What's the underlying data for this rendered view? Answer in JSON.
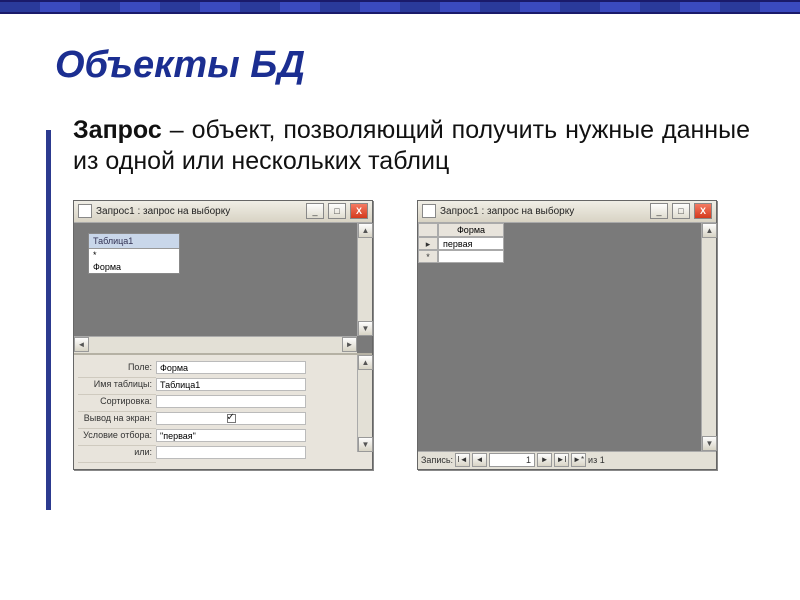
{
  "slide": {
    "title": "Объекты БД",
    "term": "Запрос",
    "definition": "– объект, позволяющий получить нужные данные из одной или нескольких таблиц"
  },
  "windows": {
    "left": {
      "title": "Запрос1 : запрос на выборку",
      "table_box": {
        "header": "Таблица1",
        "rows": [
          "*",
          "Форма"
        ]
      },
      "properties": [
        {
          "label": "Поле:",
          "value": "Форма"
        },
        {
          "label": "Имя таблицы:",
          "value": "Таблица1"
        },
        {
          "label": "Сортировка:",
          "value": ""
        },
        {
          "label": "Вывод на экран:",
          "value": "",
          "checkbox": true,
          "checked": true
        },
        {
          "label": "Условие отбора:",
          "value": "\"первая\""
        },
        {
          "label": "или:",
          "value": ""
        }
      ]
    },
    "right": {
      "title": "Запрос1 : запрос на выборку",
      "column_header": "Форма",
      "rows": [
        {
          "marker": "▸",
          "value": "первая"
        },
        {
          "marker": "*",
          "value": ""
        }
      ],
      "nav": {
        "label": "Запись:",
        "current": "1",
        "total_text": "из 1"
      }
    }
  },
  "icons": {
    "minimize": "_",
    "maximize": "□",
    "close": "X",
    "left": "◄",
    "right": "►",
    "first": "I◄",
    "last": "►I",
    "new": "►*"
  }
}
